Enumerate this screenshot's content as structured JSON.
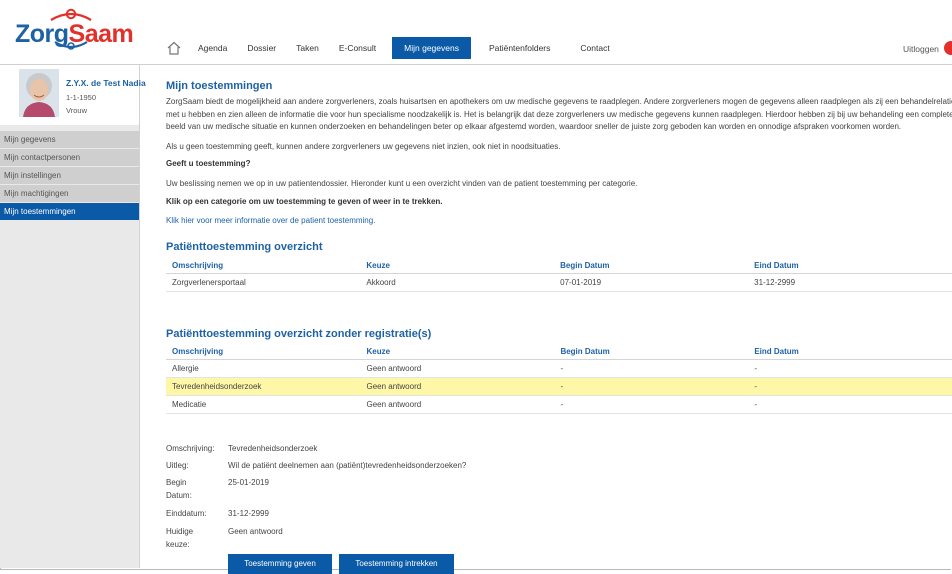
{
  "header": {
    "logo": {
      "part1": "Zorg",
      "part2": "Saam"
    },
    "nav": [
      "Agenda",
      "Dossier",
      "Taken",
      "E-Consult",
      "Mijn gegevens",
      "Patiëntenfolders",
      "Contact"
    ],
    "active_nav": "Mijn gegevens",
    "logout": "Uitloggen"
  },
  "profile": {
    "name": "Z.Y.X. de Test Nadia",
    "dob": "1-1-1950",
    "sex": "Vrouw"
  },
  "sidebar": {
    "items": [
      "Mijn gegevens",
      "Mijn contactpersonen",
      "Mijn instellingen",
      "Mijn machtigingen",
      "Mijn toestemmingen"
    ],
    "active": "Mijn toestemmingen"
  },
  "main": {
    "title": "Mijn toestemmingen",
    "intro": [
      "ZorgSaam biedt de mogelijkheid aan andere zorgverleners, zoals huisartsen en apothekers om uw medische gegevens te raadplegen. Andere zorgverleners mogen de gegevens alleen raadplegen als zij een behandelrelatie",
      "met u hebben en zien alleen de informatie die voor hun specialisme noodzakelijk is. Het is belangrijk dat deze zorgverleners uw medische gegevens kunnen raadplegen. Hierdoor hebben zij bij uw behandeling een complete",
      "beeld van uw medische situatie en kunnen onderzoeken en behandelingen beter op elkaar afgestemd worden, waardoor sneller de juiste zorg geboden kan worden en onnodige afspraken voorkomen worden."
    ],
    "para_no_consent": "Als u geen toestemming geeft, kunnen andere zorgverleners uw gegevens niet inzien, ook niet in noodsituaties.",
    "question": "Geeft u toestemming?",
    "para_decision": "Uw beslissing nemen we op in uw patientendossier. Hieronder kunt u een overzicht vinden van de patient toestemming per categorie.",
    "instruction": "Klik op een categorie om uw toestemming te geven of weer in te trekken.",
    "info_link": "Klik hier voor meer informatie over de patient toestemming.",
    "overview": {
      "title": "Patiënttoestemming overzicht",
      "columns": [
        "Omschrijving",
        "Keuze",
        "Begin Datum",
        "Eind Datum"
      ],
      "rows": [
        [
          "Zorgverlenersportaal",
          "Akkoord",
          "07-01-2019",
          "31-12-2999"
        ]
      ]
    },
    "overview_unregistered": {
      "title": "Patiënttoestemming overzicht zonder registratie(s)",
      "columns": [
        "Omschrijving",
        "Keuze",
        "Begin Datum",
        "Eind Datum"
      ],
      "rows": [
        [
          "Allergie",
          "Geen antwoord",
          "-",
          "-"
        ],
        [
          "Tevredenheidsonderzoek",
          "Geen antwoord",
          "-",
          "-"
        ],
        [
          "Medicatie",
          "Geen antwoord",
          "-",
          "-"
        ]
      ],
      "highlighted_row": 1
    },
    "details": {
      "description_label": "Omschrijving:",
      "description": "Tevredenheidsonderzoek",
      "explanation_label": "Uitleg:",
      "explanation": "Wil de patiënt deelnemen aan (patiënt)tevredenheidsonderzoeken?",
      "begin_label": "Begin Datum:",
      "begin": "25-01-2019",
      "end_label": "Einddatum:",
      "end": "31-12-2999",
      "choice_label": "Huidige keuze:",
      "choice": "Geen antwoord"
    },
    "buttons": {
      "give": "Toestemming geven",
      "revoke": "Toestemming intrekken"
    }
  },
  "colors": {
    "brand_blue": "#0a5aa8",
    "brand_red": "#e2302a",
    "highlight": "#fff7a8"
  }
}
